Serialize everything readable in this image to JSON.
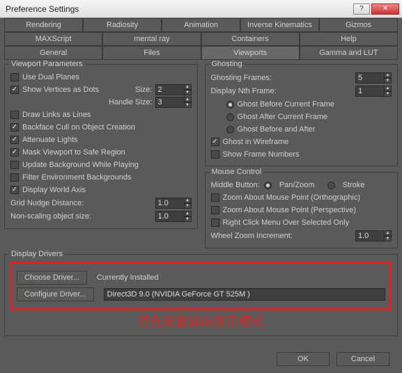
{
  "window": {
    "title": "Preference Settings",
    "help": "?",
    "close": "✕"
  },
  "tabs": {
    "r1": [
      "Rendering",
      "Radiosity",
      "Animation",
      "Inverse Kinematics",
      "Gizmos"
    ],
    "r2": [
      "MAXScript",
      "mental ray",
      "Containers",
      "Help"
    ],
    "r3": [
      "General",
      "Files",
      "Viewports",
      "Gamma and LUT"
    ],
    "selected": "Viewports"
  },
  "vp": {
    "legend": "Viewport Parameters",
    "dualplanes": "Use Dual Planes",
    "showverts": "Show Vertices as Dots",
    "sizeL": "Size:",
    "sizeV": "2",
    "hsizeL": "Handle Size:",
    "hsizeV": "3",
    "drawlinks": "Draw Links as Lines",
    "backface": "Backface Cull on Object Creation",
    "atten": "Attenuate Lights",
    "mask": "Mask Viewport to Safe Region",
    "updbg": "Update Background While Playing",
    "filter": "Filter Environment Backgrounds",
    "world": "Display World Axis",
    "gridL": "Grid Nudge Distance:",
    "gridV": "1.0",
    "nonscaleL": "Non-scaling object size:",
    "nonscaleV": "1.0"
  },
  "gh": {
    "legend": "Ghosting",
    "framesL": "Ghosting Frames:",
    "framesV": "5",
    "nthL": "Display Nth Frame:",
    "nthV": "1",
    "before": "Ghost Before Current Frame",
    "after": "Ghost After Current Frame",
    "both": "Ghost Before and After",
    "wire": "Ghost in Wireframe",
    "shownum": "Show Frame Numbers"
  },
  "mc": {
    "legend": "Mouse Control",
    "midL": "Middle Button:",
    "pan": "Pan/Zoom",
    "stroke": "Stroke",
    "ortho": "Zoom About Mouse Point (Orthographic)",
    "persp": "Zoom About Mouse Point (Perspective)",
    "rclick": "Right Click Menu Over Selected Only",
    "wheelL": "Wheel Zoom Increment:",
    "wheelV": "1.0"
  },
  "dd": {
    "legend": "Display Drivers",
    "choose": "Choose Driver...",
    "configure": "Configure Driver...",
    "installed": "Currently Installed",
    "device": "Direct3D 9.0 (NVIDIA GeForce GT 525M   )"
  },
  "annotation": "首先设置成dx显示模式",
  "footer": {
    "ok": "OK",
    "cancel": "Cancel"
  }
}
